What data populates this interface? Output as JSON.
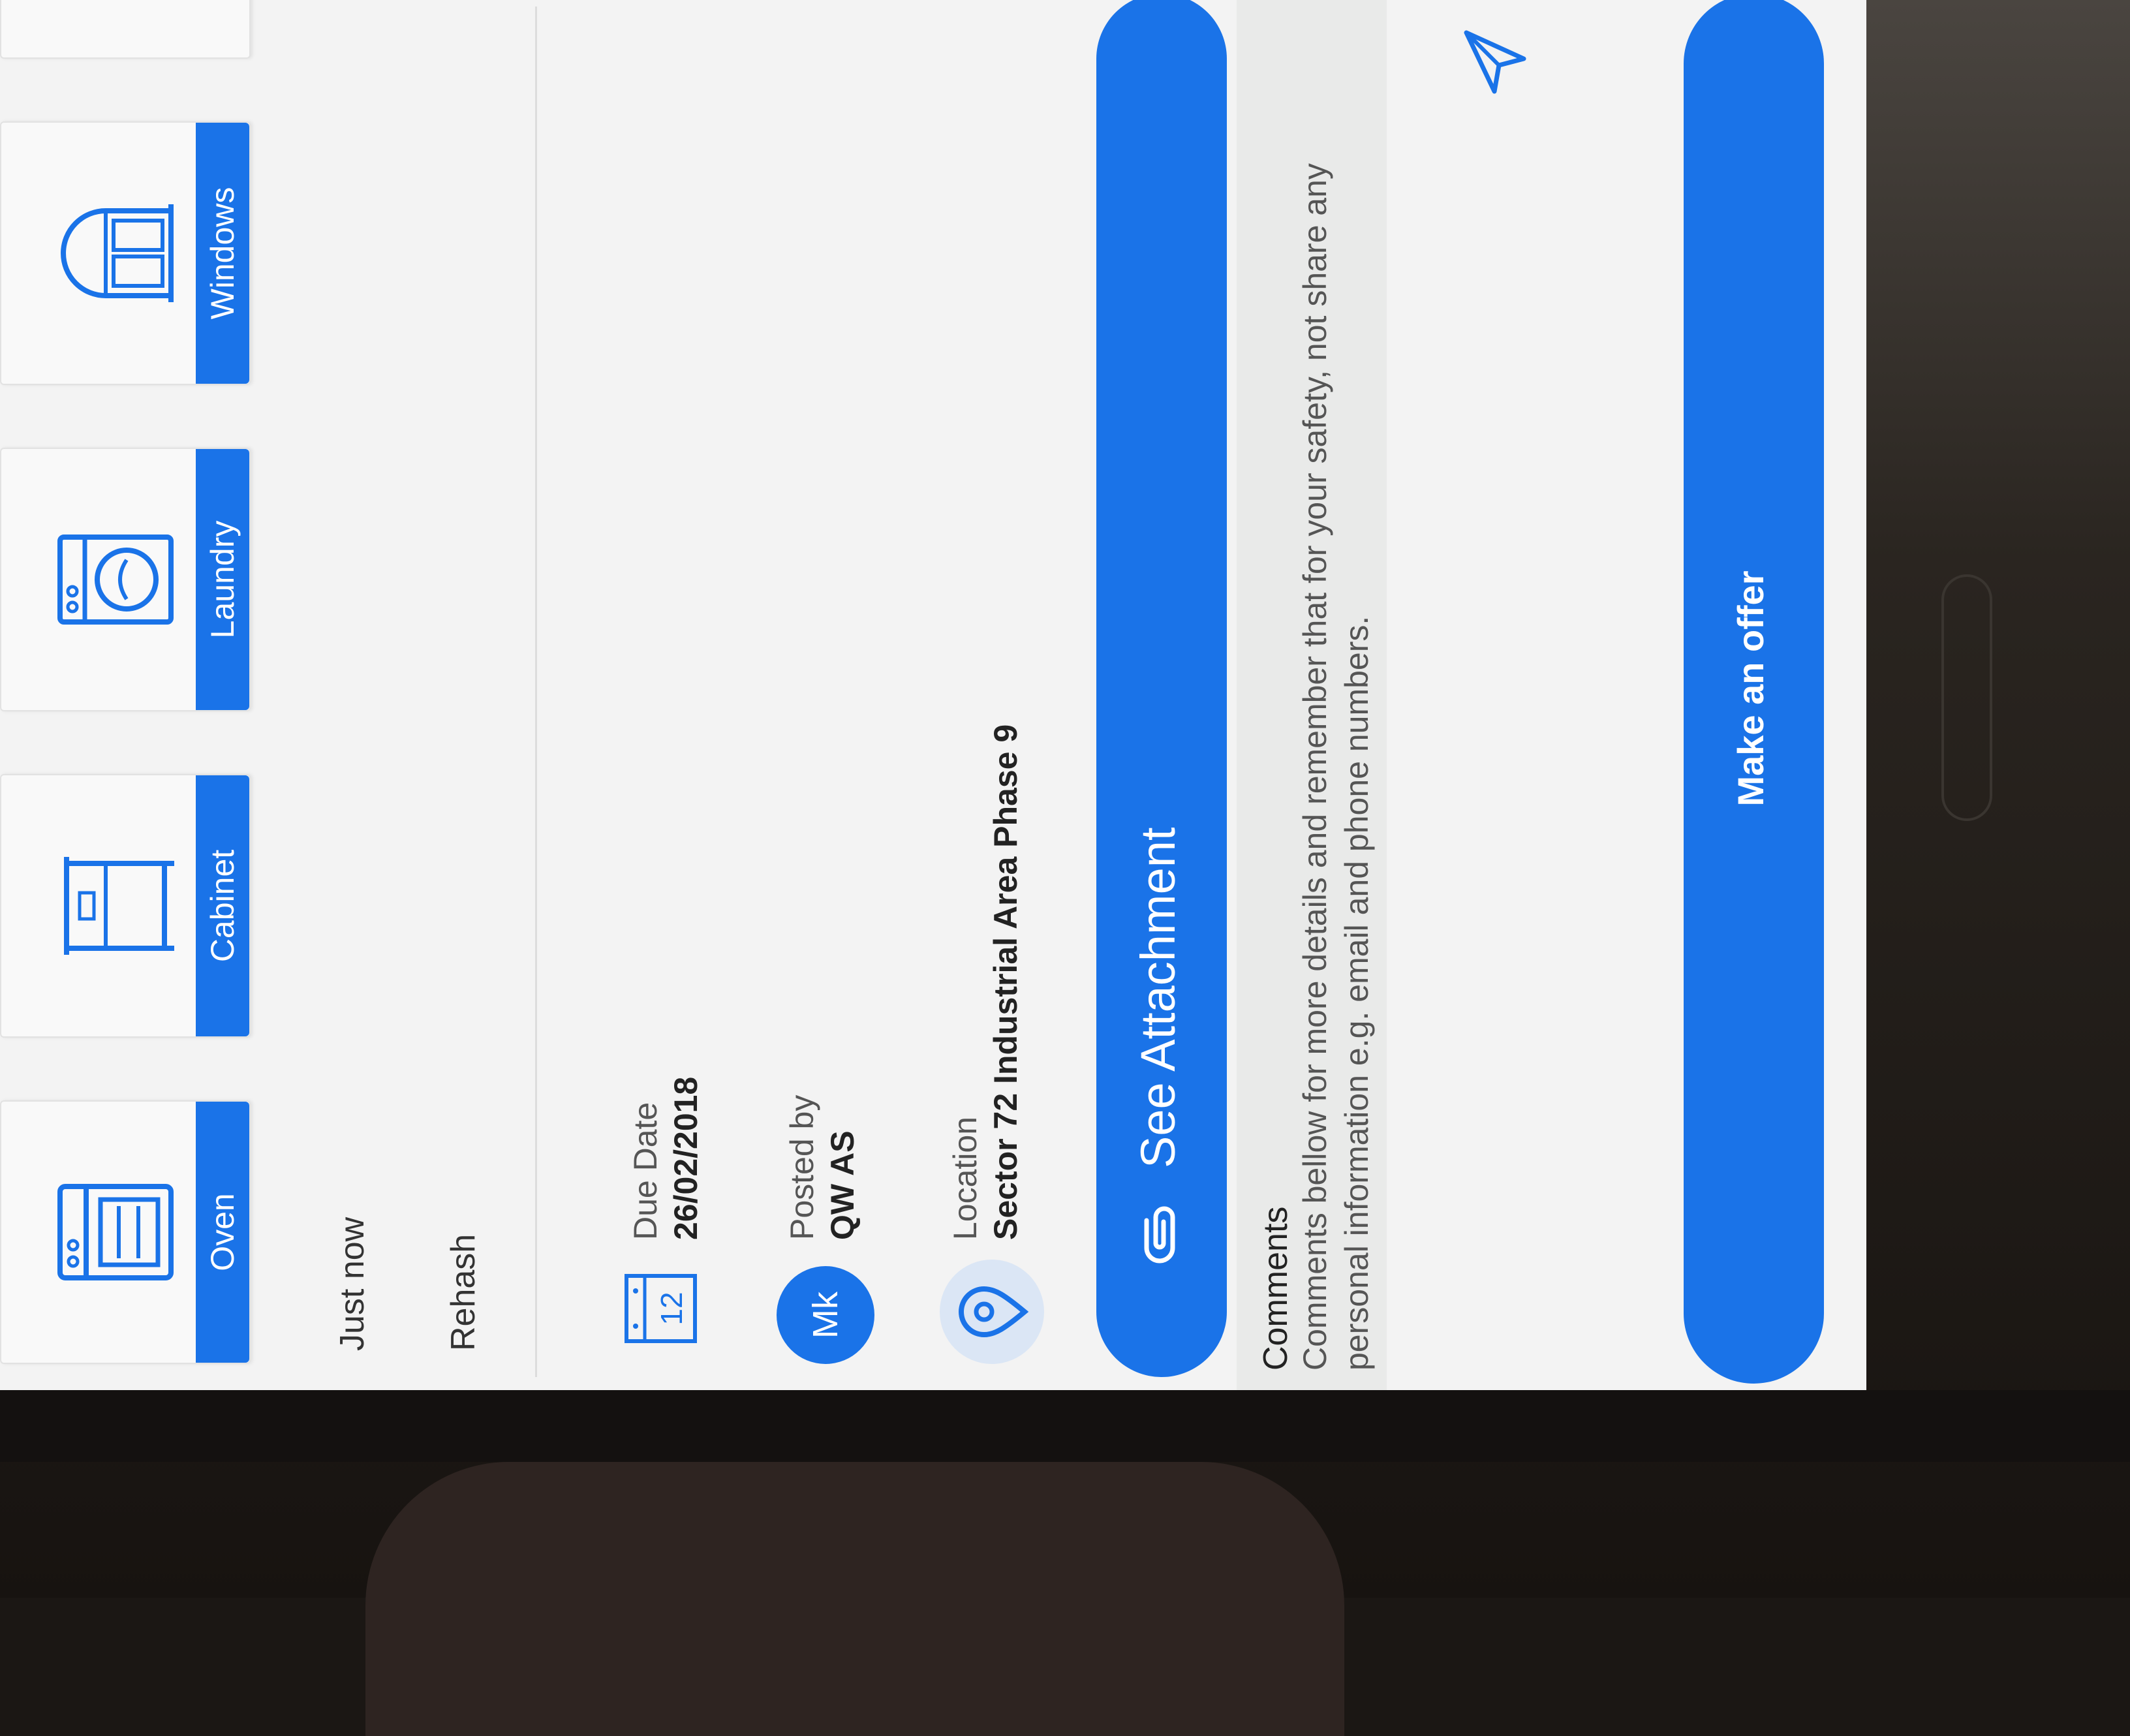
{
  "categories": [
    {
      "label": "Oven",
      "icon": "oven-icon"
    },
    {
      "label": "Cabinet",
      "icon": "cabinet-icon"
    },
    {
      "label": "Laundry",
      "icon": "washing-machine-icon"
    },
    {
      "label": "Windows",
      "icon": "window-icon"
    }
  ],
  "post": {
    "time": "Just now",
    "title": "Rehash"
  },
  "due_date": {
    "label": "Due Date",
    "value": "26/02/2018",
    "calendar_day": "12"
  },
  "posted_by": {
    "label": "Posted by",
    "value": "QW AS",
    "avatar_initials": "Mk"
  },
  "location": {
    "label": "Location",
    "value": "Sector 72 Industrial Area Phase 9"
  },
  "attachment_button": "See Attachment",
  "comments": {
    "title": "Comments",
    "text": "Comments bellow for more details and remember that for your safety, not share any personal information e.g. email and phone numbers."
  },
  "offer_button": "Make an offer",
  "colors": {
    "accent": "#1a73e8",
    "background": "#f3f3f3"
  }
}
